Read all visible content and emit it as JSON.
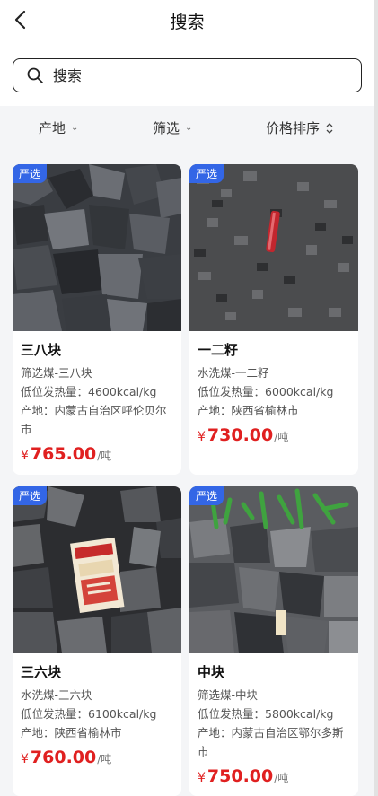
{
  "header": {
    "title": "搜索",
    "back_icon": "chevron-left-icon"
  },
  "search": {
    "placeholder": "搜索",
    "icon": "search-icon"
  },
  "filters": [
    {
      "label": "产地",
      "icon": "chevron-down-icon"
    },
    {
      "label": "筛选",
      "icon": "chevron-down-icon"
    },
    {
      "label": "价格排序",
      "icon": "sort-icon"
    }
  ],
  "products": [
    {
      "tag": "严选",
      "name": "三八块",
      "type": "筛选煤-三八块",
      "heat": "低位发热量：4600kcal/kg",
      "origin": "产地：内蒙古自治区呼伦贝尔市",
      "currency": "¥",
      "price": "765.00",
      "unit": "/吨"
    },
    {
      "tag": "严选",
      "name": "一二籽",
      "type": "水洗煤-一二籽",
      "heat": "低位发热量：6000kcal/kg",
      "origin": "产地：陕西省榆林市",
      "currency": "¥",
      "price": "730.00",
      "unit": "/吨"
    },
    {
      "tag": "严选",
      "name": "三六块",
      "type": "水洗煤-三六块",
      "heat": "低位发热量：6100kcal/kg",
      "origin": "产地：陕西省榆林市",
      "currency": "¥",
      "price": "760.00",
      "unit": "/吨"
    },
    {
      "tag": "严选",
      "name": "中块",
      "type": "筛选煤-中块",
      "heat": "低位发热量：5800kcal/kg",
      "origin": "产地：内蒙古自治区鄂尔多斯市",
      "currency": "¥",
      "price": "750.00",
      "unit": "/吨"
    }
  ],
  "colors": {
    "accent_tag": "#3366e6",
    "price": "#e02020"
  }
}
